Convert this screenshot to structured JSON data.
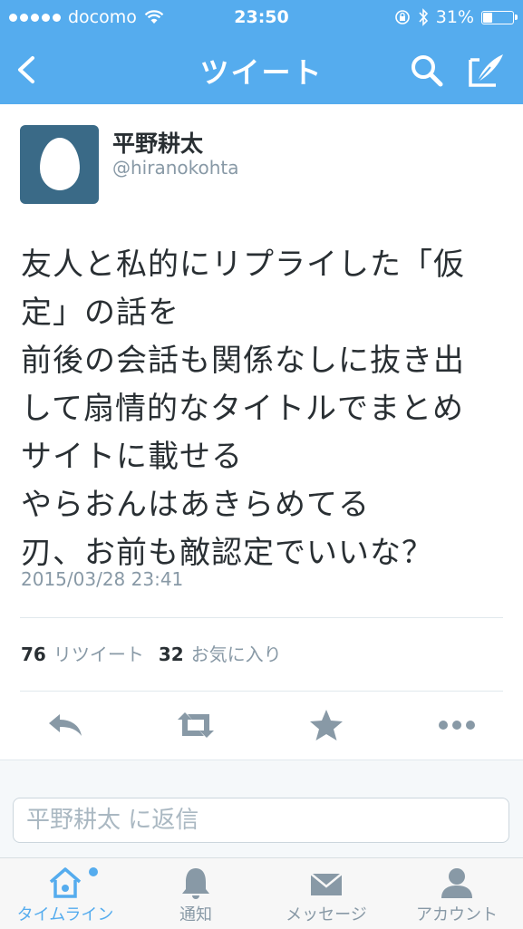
{
  "status_bar": {
    "carrier": "docomo",
    "time": "23:50",
    "battery_text": "31%",
    "battery_level": 0.31
  },
  "nav": {
    "title": "ツイート",
    "icons": [
      "back-chevron-icon",
      "search-icon",
      "compose-icon"
    ]
  },
  "tweet": {
    "display_name": "平野耕太",
    "handle": "@hiranokohta",
    "text": "友人と私的にリプライした「仮\n定」の話を\n前後の会話も関係なしに抜き出\nして扇情的なタイトルでまとめ\nサイトに載せる\nやらおんはあきらめてる\n刃、お前も敵認定でいいな？",
    "timestamp": "2015/03/28 23:41",
    "retweet_count": "76",
    "retweet_label": "リツイート",
    "favorite_count": "32",
    "favorite_label": "お気に入り"
  },
  "actions": {
    "icons": [
      "reply-icon",
      "retweet-icon",
      "favorite-star-icon",
      "more-icon"
    ]
  },
  "reply": {
    "placeholder": "平野耕太 に返信"
  },
  "tabbar": {
    "items": [
      {
        "label": "タイムライン",
        "icon": "home-icon",
        "active": true
      },
      {
        "label": "通知",
        "icon": "bell-icon",
        "active": false
      },
      {
        "label": "メッセージ",
        "icon": "envelope-icon",
        "active": false
      },
      {
        "label": "アカウント",
        "icon": "person-icon",
        "active": false
      }
    ]
  },
  "colors": {
    "brand": "#55acee",
    "text": "#292f33",
    "muted": "#8899a6",
    "action_icon": "#8899a6"
  }
}
